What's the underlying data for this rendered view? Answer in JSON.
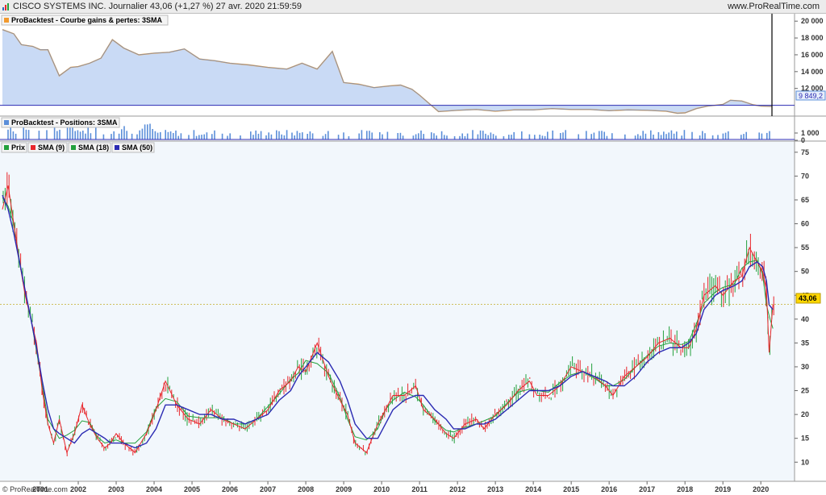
{
  "header": {
    "title": "CISCO SYSTEMS INC. Journalier 43,06 (+1,27 %) 27 avr. 2020 21:59:59",
    "site": "www.ProRealTime.com"
  },
  "footer": {
    "credit": "© ProRealTime.com"
  },
  "colors": {
    "price_bg": "#f2f7fc",
    "sma9": "#e8262b",
    "sma18": "#23a03c",
    "sma50": "#2b2bb3",
    "equity_fill_pos": "#c9daf5",
    "equity_fill_neg": "#fbd9b5",
    "equity_line": "#5b8fd9",
    "equity_orange": "#f29a2e",
    "position_bar": "#5b8fd9",
    "price_marker_bg": "#ffd700"
  },
  "chart_data": [
    {
      "type": "area",
      "panel": "equity",
      "legend": "ProBacktest - Courbe gains & pertes: 3SMA",
      "y_ticks": [
        "20 000",
        "18 000",
        "16 000",
        "14 000",
        "12 000"
      ],
      "ylim": [
        9000,
        20500
      ],
      "reference": 10000,
      "last_value_label": "9 849,2",
      "x": [
        2000.0,
        2000.3,
        2000.5,
        2000.8,
        2001.0,
        2001.2,
        2001.5,
        2001.8,
        2002.0,
        2002.3,
        2002.6,
        2002.9,
        2003.2,
        2003.6,
        2004.0,
        2004.4,
        2004.8,
        2005.2,
        2005.6,
        2006.0,
        2006.5,
        2007.0,
        2007.5,
        2007.9,
        2008.3,
        2008.7,
        2009.0,
        2009.4,
        2009.8,
        2010.2,
        2010.5,
        2010.8,
        2011.0,
        2011.5,
        2012.0,
        2012.5,
        2013.0,
        2013.5,
        2014.0,
        2014.5,
        2015.0,
        2015.5,
        2016.0,
        2016.5,
        2017.0,
        2017.5,
        2017.8,
        2018.0,
        2018.3,
        2018.6,
        2019.0,
        2019.2,
        2019.5,
        2019.8,
        2020.0,
        2020.3
      ],
      "y": [
        19000,
        18500,
        17200,
        17000,
        16600,
        16600,
        13500,
        14500,
        14600,
        15000,
        15600,
        17800,
        16800,
        16000,
        16200,
        16300,
        16700,
        15500,
        15300,
        15000,
        14800,
        14500,
        14300,
        15000,
        14300,
        16400,
        12700,
        12500,
        12100,
        12300,
        12400,
        11900,
        11200,
        9250,
        9400,
        9500,
        9300,
        9450,
        9450,
        9600,
        9500,
        9500,
        9350,
        9450,
        9400,
        9300,
        9050,
        9100,
        9600,
        9900,
        10100,
        10600,
        10500,
        10050,
        9900,
        9850
      ]
    },
    {
      "type": "bar",
      "panel": "positions",
      "legend": "ProBacktest - Positions: 3SMA",
      "y_ticks": [
        "1 000",
        "0"
      ]
    },
    {
      "type": "line",
      "panel": "price",
      "legend": [
        "Prix",
        "SMA (9)",
        "SMA (18)",
        "SMA (50)"
      ],
      "y_ticks": [
        75,
        70,
        65,
        60,
        55,
        50,
        45,
        40,
        35,
        30,
        25,
        20,
        15,
        10
      ],
      "ylim": [
        7,
        77
      ],
      "last_price_label": "43,06",
      "x_labels": [
        "2001",
        "2002",
        "2003",
        "2004",
        "2005",
        "2006",
        "2007",
        "2008",
        "2009",
        "2010",
        "2011",
        "2012",
        "2013",
        "2014",
        "2015",
        "2016",
        "2017",
        "2018",
        "2019",
        "2020"
      ],
      "x": [
        2000.0,
        2000.15,
        2000.3,
        2000.45,
        2000.6,
        2000.75,
        2000.9,
        2001.05,
        2001.2,
        2001.35,
        2001.5,
        2001.7,
        2001.9,
        2002.1,
        2002.3,
        2002.5,
        2002.7,
        2002.85,
        2003.0,
        2003.2,
        2003.5,
        2003.8,
        2004.05,
        2004.3,
        2004.6,
        2004.9,
        2005.2,
        2005.5,
        2005.8,
        2006.1,
        2006.4,
        2006.7,
        2007.0,
        2007.3,
        2007.6,
        2007.8,
        2008.0,
        2008.3,
        2008.6,
        2008.9,
        2009.1,
        2009.3,
        2009.6,
        2009.9,
        2010.1,
        2010.3,
        2010.6,
        2010.9,
        2011.1,
        2011.4,
        2011.7,
        2011.9,
        2012.2,
        2012.5,
        2012.7,
        2013.0,
        2013.3,
        2013.6,
        2013.9,
        2014.1,
        2014.4,
        2014.7,
        2015.0,
        2015.3,
        2015.6,
        2015.9,
        2016.1,
        2016.4,
        2016.7,
        2017.0,
        2017.3,
        2017.6,
        2017.9,
        2018.1,
        2018.3,
        2018.5,
        2018.8,
        2019.0,
        2019.3,
        2019.5,
        2019.7,
        2019.9,
        2020.05,
        2020.15,
        2020.22,
        2020.32
      ],
      "y": [
        63,
        68,
        60,
        52,
        45,
        40,
        35,
        25,
        18,
        14,
        19,
        12,
        16,
        22,
        18,
        15,
        13,
        14,
        16,
        14,
        12,
        16,
        21,
        27,
        22,
        19,
        18,
        21,
        19,
        18,
        17,
        19,
        21,
        25,
        27,
        30,
        29,
        35,
        28,
        23,
        20,
        14,
        12,
        18,
        21,
        24,
        24,
        26,
        21,
        19,
        16,
        15,
        18,
        19,
        17,
        20,
        22,
        25,
        27,
        24,
        24,
        26,
        30,
        29,
        28,
        26,
        24,
        28,
        30,
        32,
        35,
        36,
        34,
        34,
        38,
        45,
        47,
        45,
        48,
        49,
        55,
        52,
        50,
        46,
        33,
        43.06
      ],
      "sma50_y": [
        66,
        63,
        58,
        52,
        46,
        40,
        34,
        27,
        21,
        17,
        16,
        15,
        14,
        16,
        17,
        16,
        15,
        14,
        14,
        14,
        13,
        14,
        17,
        22,
        22,
        21,
        20,
        20,
        19,
        19,
        18,
        19,
        20,
        23,
        25,
        28,
        30,
        33,
        31,
        27,
        23,
        18,
        15,
        15,
        18,
        21,
        23,
        24,
        24,
        21,
        19,
        17,
        17,
        18,
        18,
        19,
        21,
        23,
        25,
        25,
        25,
        26,
        28,
        29,
        28,
        27,
        26,
        26,
        28,
        31,
        33,
        34,
        34,
        35,
        37,
        42,
        45,
        46,
        47,
        48,
        51,
        52,
        51,
        48,
        43,
        42
      ]
    }
  ]
}
